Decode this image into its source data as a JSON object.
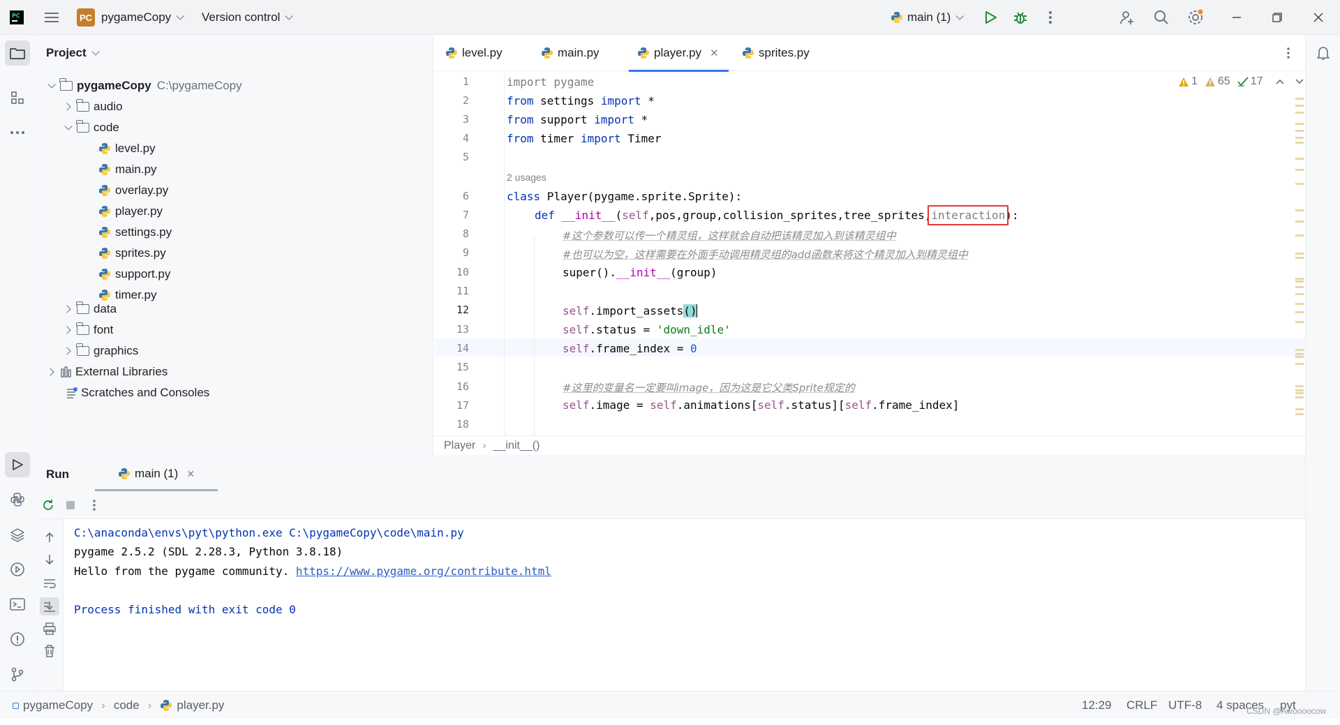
{
  "titlebar": {
    "project_badge": "PC",
    "project_name": "pygameCopy",
    "version_control": "Version control",
    "run_config": "main (1)"
  },
  "project_panel": {
    "title": "Project",
    "tree": {
      "root": {
        "name": "pygameCopy",
        "path": "C:\\pygameCopy"
      },
      "audio": "audio",
      "code": "code",
      "files": [
        "level.py",
        "main.py",
        "overlay.py",
        "player.py",
        "settings.py",
        "sprites.py",
        "support.py",
        "timer.py"
      ],
      "data": "data",
      "font": "font",
      "graphics": "graphics",
      "external": "External Libraries",
      "scratches": "Scratches and Consoles"
    }
  },
  "editor": {
    "tabs": [
      "level.py",
      "main.py",
      "player.py",
      "sprites.py"
    ],
    "active_tab": "player.py",
    "inspections": {
      "errors": "1",
      "warnings": "65",
      "ok": "17"
    },
    "usages_hint": "2 usages",
    "line_numbers": [
      "1",
      "2",
      "3",
      "4",
      "5",
      "6",
      "7",
      "8",
      "9",
      "10",
      "11",
      "12",
      "13",
      "14",
      "15",
      "16",
      "17",
      "18"
    ],
    "code": {
      "l1_a": "import",
      "l1_b": " pygame",
      "l2_a": "from",
      "l2_b": " settings ",
      "l2_c": "import",
      "l2_d": " *",
      "l3_a": "from",
      "l3_b": " support ",
      "l3_c": "import",
      "l3_d": " *",
      "l4_a": "from",
      "l4_b": " timer ",
      "l4_c": "import",
      "l4_d": " Timer",
      "l6_a": "class",
      "l6_b": " Player(pygame.sprite.Sprite):",
      "l7_a": "def",
      "l7_b": " __init__",
      "l7_c": "(",
      "l7_d": "self",
      "l7_e": ",pos,group,collision_sprites,tree_sprites,",
      "l7_f": "interaction",
      "l7_g": "):",
      "l8": "#这个参数可以传一个精灵组，这样就会自动把该精灵加入到该精灵组中",
      "l9": "#也可以为空，这样需要在外面手动调用精灵组的add函数来将这个精灵加入到精灵组中",
      "l10_a": "super().",
      "l10_b": "__init__",
      "l10_c": "(group)",
      "l12_a": "self",
      "l12_b": ".import_assets",
      "l12_c": "()",
      "l13_a": "self",
      "l13_b": ".status = ",
      "l13_c": "'down_idle'",
      "l14_a": "self",
      "l14_b": ".frame_index = ",
      "l14_c": "0",
      "l16": "#这里的变量名一定要叫image，因为这是它父类Sprite规定的",
      "l17_a": "self",
      "l17_b": ".image = ",
      "l17_c": "self",
      "l17_d": ".animations[",
      "l17_e": "self",
      "l17_f": ".status][",
      "l17_g": "self",
      "l17_h": ".frame_index]"
    },
    "breadcrumb": [
      "Player",
      "__init__()"
    ]
  },
  "run_panel": {
    "title": "Run",
    "tab": "main (1)",
    "output": {
      "cmd": "C:\\anaconda\\envs\\pyt\\python.exe C:\\pygameCopy\\code\\main.py",
      "line2": "pygame 2.5.2 (SDL 2.28.3, Python 3.8.18)",
      "line3_text": "Hello from the pygame community. ",
      "line3_link": "https://www.pygame.org/contribute.html",
      "finished": "Process finished with exit code 0"
    }
  },
  "statusbar": {
    "breadcrumb": [
      "pygameCopy",
      "code",
      "player.py"
    ],
    "position": "12:29",
    "line_sep": "CRLF",
    "encoding": "UTF-8",
    "indent": "4 spaces",
    "lang": "pyt",
    "watermark": "CSDN @Awoooocow"
  },
  "colors": {
    "accent": "#3574f0",
    "highlight_box": "#e53935",
    "keyword": "#0033b3",
    "self": "#94558d",
    "string": "#067d17"
  },
  "icons": [
    "pycharm-logo-icon",
    "hamburger-menu-icon",
    "python-icon",
    "run-icon",
    "debug-icon",
    "more-vertical-icon",
    "add-user-icon",
    "search-icon",
    "settings-icon",
    "minimize-icon",
    "restore-icon",
    "close-icon",
    "folder-icon",
    "structure-icon",
    "more-horizontal-icon",
    "run-tool-icon",
    "python-console-icon",
    "layers-icon",
    "services-icon",
    "terminal-icon",
    "problems-icon",
    "git-icon",
    "notifications-icon",
    "rerun-icon",
    "stop-icon",
    "up-arrow-icon",
    "down-arrow-icon",
    "soft-wrap-icon",
    "scroll-to-end-icon",
    "print-icon",
    "trash-icon",
    "warning-icon",
    "check-icon"
  ]
}
